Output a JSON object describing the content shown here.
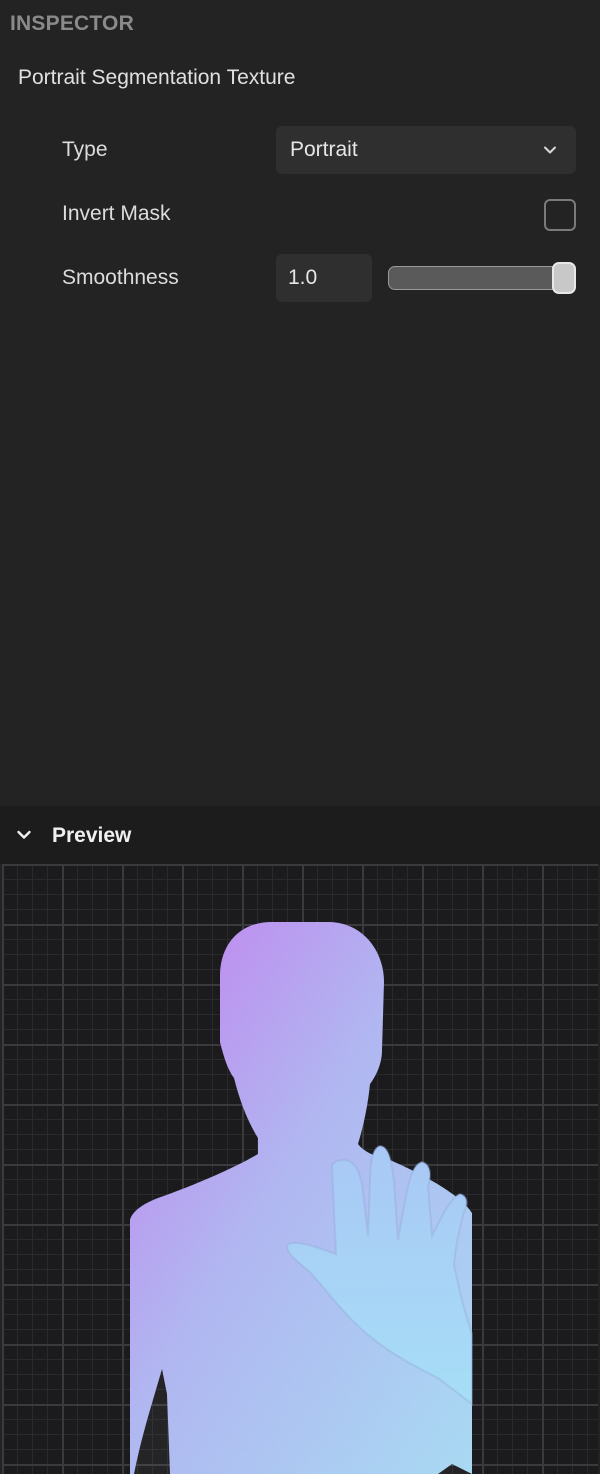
{
  "panel": {
    "title": "INSPECTOR"
  },
  "section": {
    "title": "Portrait Segmentation Texture"
  },
  "properties": {
    "type": {
      "label": "Type",
      "value": "Portrait"
    },
    "invert_mask": {
      "label": "Invert Mask",
      "checked": false
    },
    "smoothness": {
      "label": "Smoothness",
      "value": "1.0",
      "slider_fraction": 1.0
    }
  },
  "preview": {
    "label": "Preview",
    "expanded": true
  },
  "icons": {
    "dropdown": "chevron-down-icon",
    "preview_toggle": "chevron-down-icon"
  },
  "colors": {
    "background": "#232323",
    "field_background": "#2f2f2f",
    "preview_background": "#1b1b1d",
    "silhouette_gradient": [
      "#c47cf2",
      "#b0b6f4",
      "#a7dbf6"
    ]
  }
}
